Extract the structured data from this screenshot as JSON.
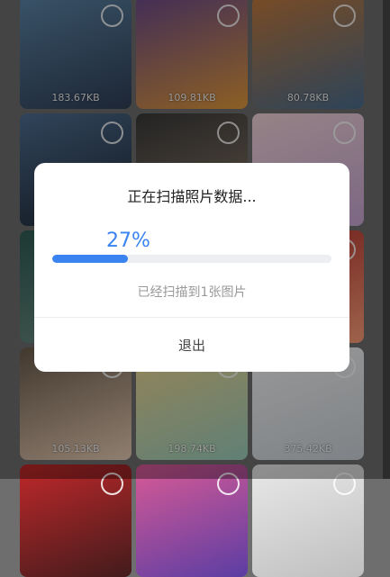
{
  "gallery": {
    "tiles": [
      {
        "size": "183.67KB",
        "colors": [
          "#5d86a8",
          "#2f3e56"
        ]
      },
      {
        "size": "109.81KB",
        "colors": [
          "#6c4b8c",
          "#e29a3b"
        ]
      },
      {
        "size": "80.78KB",
        "colors": [
          "#c27a3d",
          "#4a6e8f"
        ]
      },
      {
        "size": "",
        "colors": [
          "#4f6f92",
          "#1d2633"
        ]
      },
      {
        "size": "",
        "colors": [
          "#3a3a3a",
          "#8f7c6a"
        ]
      },
      {
        "size": "",
        "colors": [
          "#f1d4d8",
          "#c9a7d6"
        ]
      },
      {
        "size": "",
        "colors": [
          "#2f5c54",
          "#708f86"
        ]
      },
      {
        "size": "",
        "colors": [
          "#b8c7c9",
          "#e6c5b6"
        ]
      },
      {
        "size": "",
        "colors": [
          "#b4302c",
          "#ffa07a"
        ]
      },
      {
        "size": "105.13KB",
        "colors": [
          "#6b5b4b",
          "#e8cdb5"
        ]
      },
      {
        "size": "198.74KB",
        "colors": [
          "#f0d68f",
          "#9ccfbe"
        ]
      },
      {
        "size": "375.42KB",
        "colors": [
          "#f6f6f6",
          "#ccd3d9"
        ]
      },
      {
        "size": "",
        "colors": [
          "#c0282a",
          "#421b1c"
        ]
      },
      {
        "size": "",
        "colors": [
          "#d85a95",
          "#5b3da3"
        ]
      },
      {
        "size": "",
        "colors": [
          "#e8e8e8",
          "#bfbfbf"
        ]
      }
    ]
  },
  "dialog": {
    "title": "正在扫描照片数据...",
    "progress_text": "27%",
    "progress_fraction": 0.27,
    "status": "已经扫描到1张图片",
    "exit_label": "退出"
  }
}
